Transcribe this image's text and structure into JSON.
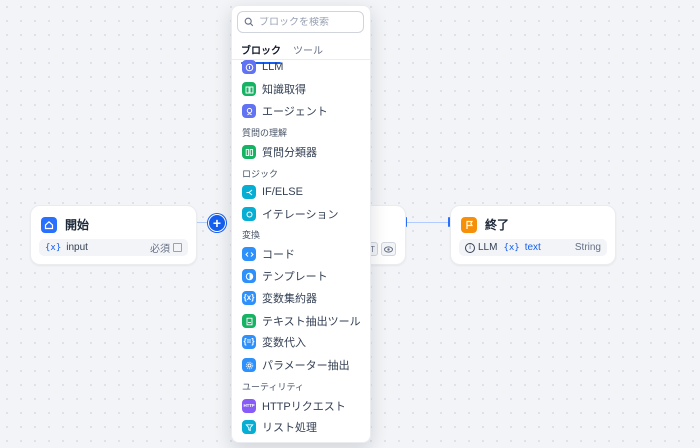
{
  "colors": {
    "accent": "#155eef",
    "llm": "#6172f3",
    "green": "#16b364",
    "teal": "#06aed4",
    "blue": "#2e90fa",
    "purple": "#875bf7",
    "orange": "#f79009"
  },
  "start_node": {
    "title": "開始",
    "icon": "home-icon",
    "var_glyph": "{x}",
    "var_name": "input",
    "required_label": "必須"
  },
  "end_node": {
    "title": "終了",
    "icon": "flag-icon",
    "source_label": "LLM",
    "var_glyph": "{x}",
    "var_name": "text",
    "type_label": "String"
  },
  "middle_node": {
    "partial_label": "T"
  },
  "add_button": {
    "label": "+"
  },
  "block_menu": {
    "search_placeholder": "ブロックを検索",
    "tabs": [
      "ブロック",
      "ツール"
    ],
    "items": [
      {
        "label": "LLM",
        "icon": "llm-icon"
      },
      {
        "label": "知識取得",
        "icon": "book-icon"
      },
      {
        "label": "エージェント",
        "icon": "agent-icon"
      },
      {
        "section": "質問の理解"
      },
      {
        "label": "質問分類器",
        "icon": "classifier-icon"
      },
      {
        "section": "ロジック"
      },
      {
        "label": "IF/ELSE",
        "icon": "branch-icon"
      },
      {
        "label": "イテレーション",
        "icon": "loop-icon"
      },
      {
        "section": "変換"
      },
      {
        "label": "コード",
        "icon": "code-icon"
      },
      {
        "label": "テンプレート",
        "icon": "template-icon"
      },
      {
        "label": "変数集約器",
        "icon": "aggregator-icon"
      },
      {
        "label": "テキスト抽出ツール",
        "icon": "doc-extract-icon"
      },
      {
        "label": "変数代入",
        "icon": "assign-icon"
      },
      {
        "label": "パラメーター抽出",
        "icon": "param-icon"
      },
      {
        "section": "ユーティリティ"
      },
      {
        "label": "HTTPリクエスト",
        "icon": "http-icon"
      },
      {
        "label": "リスト処理",
        "icon": "filter-icon"
      }
    ],
    "http_badge_text": "HTTP"
  }
}
